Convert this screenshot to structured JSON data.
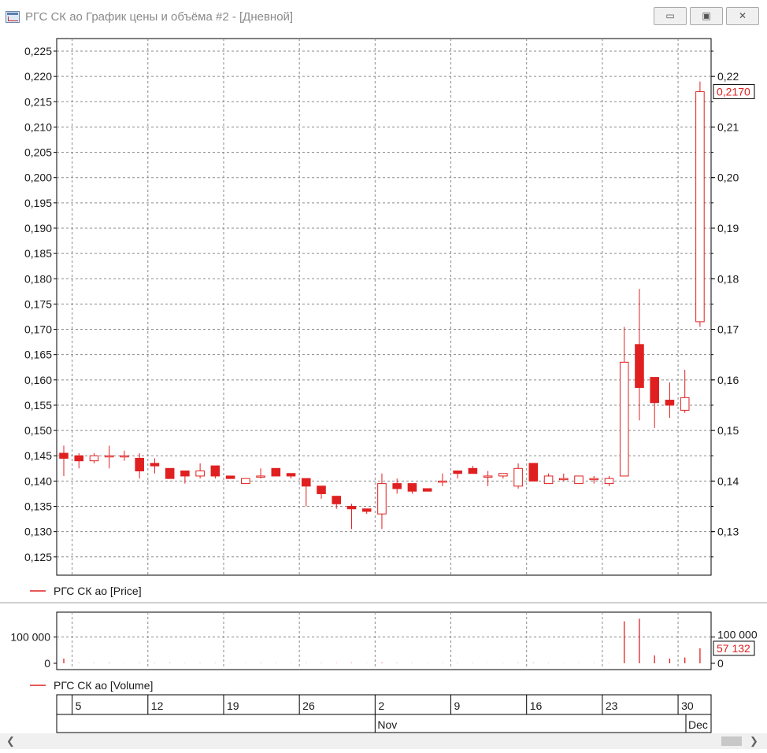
{
  "window": {
    "title": "РГС СК ао График цены и объёма #2 - [Дневной]",
    "buttons": {
      "minimize": "▭",
      "maximize": "▣",
      "close": "✕"
    }
  },
  "colors": {
    "candle": "#e02020",
    "grid": "#8a8a8a",
    "axis": "#000000",
    "text": "#1a1a1a"
  },
  "chart_data": [
    {
      "type": "candlestick",
      "legend": "РГС СК ао [Price]",
      "left_axis": {
        "min": 0.125,
        "max": 0.225,
        "step": 0.005,
        "labels": [
          "0,125",
          "0,130",
          "0,135",
          "0,140",
          "0,145",
          "0,150",
          "0,155",
          "0,160",
          "0,165",
          "0,170",
          "0,175",
          "0,180",
          "0,185",
          "0,190",
          "0,195",
          "0,200",
          "0,205",
          "0,210",
          "0,215",
          "0,220",
          "0,225"
        ]
      },
      "right_axis": {
        "ticks": [
          0.13,
          0.14,
          0.15,
          0.16,
          0.17,
          0.18,
          0.19,
          0.2,
          0.21,
          0.22
        ],
        "labels": [
          "0,13",
          "0,14",
          "0,15",
          "0,16",
          "0,17",
          "0,18",
          "0,19",
          "0,20",
          "0,21",
          "0,22"
        ]
      },
      "last_value_label": "0,2170",
      "last_value": 0.217,
      "grid": true,
      "candles": [
        {
          "o": 0.1455,
          "h": 0.147,
          "l": 0.141,
          "c": 0.1445
        },
        {
          "o": 0.145,
          "h": 0.1455,
          "l": 0.1425,
          "c": 0.144
        },
        {
          "o": 0.144,
          "h": 0.1455,
          "l": 0.1435,
          "c": 0.145
        },
        {
          "o": 0.145,
          "h": 0.147,
          "l": 0.1425,
          "c": 0.145
        },
        {
          "o": 0.145,
          "h": 0.146,
          "l": 0.144,
          "c": 0.145
        },
        {
          "o": 0.1445,
          "h": 0.1455,
          "l": 0.1405,
          "c": 0.142
        },
        {
          "o": 0.1435,
          "h": 0.1445,
          "l": 0.1415,
          "c": 0.143
        },
        {
          "o": 0.1425,
          "h": 0.1425,
          "l": 0.1405,
          "c": 0.1405
        },
        {
          "o": 0.142,
          "h": 0.142,
          "l": 0.1395,
          "c": 0.141
        },
        {
          "o": 0.141,
          "h": 0.1435,
          "l": 0.1405,
          "c": 0.142
        },
        {
          "o": 0.143,
          "h": 0.143,
          "l": 0.1405,
          "c": 0.141
        },
        {
          "o": 0.141,
          "h": 0.141,
          "l": 0.1405,
          "c": 0.1405
        },
        {
          "o": 0.1395,
          "h": 0.1405,
          "l": 0.1395,
          "c": 0.1405
        },
        {
          "o": 0.141,
          "h": 0.1425,
          "l": 0.1405,
          "c": 0.141
        },
        {
          "o": 0.1425,
          "h": 0.1425,
          "l": 0.141,
          "c": 0.141
        },
        {
          "o": 0.1415,
          "h": 0.1415,
          "l": 0.1405,
          "c": 0.141
        },
        {
          "o": 0.1405,
          "h": 0.1405,
          "l": 0.135,
          "c": 0.139
        },
        {
          "o": 0.139,
          "h": 0.139,
          "l": 0.1365,
          "c": 0.1375
        },
        {
          "o": 0.137,
          "h": 0.137,
          "l": 0.1345,
          "c": 0.1355
        },
        {
          "o": 0.135,
          "h": 0.1355,
          "l": 0.1305,
          "c": 0.1345
        },
        {
          "o": 0.1345,
          "h": 0.1345,
          "l": 0.1335,
          "c": 0.134
        },
        {
          "o": 0.1335,
          "h": 0.1415,
          "l": 0.1305,
          "c": 0.1395
        },
        {
          "o": 0.1395,
          "h": 0.1405,
          "l": 0.1375,
          "c": 0.1385
        },
        {
          "o": 0.1395,
          "h": 0.1395,
          "l": 0.1375,
          "c": 0.138
        },
        {
          "o": 0.1385,
          "h": 0.1385,
          "l": 0.138,
          "c": 0.138
        },
        {
          "o": 0.14,
          "h": 0.1415,
          "l": 0.139,
          "c": 0.14
        },
        {
          "o": 0.142,
          "h": 0.142,
          "l": 0.1405,
          "c": 0.1415
        },
        {
          "o": 0.1425,
          "h": 0.143,
          "l": 0.1415,
          "c": 0.1415
        },
        {
          "o": 0.141,
          "h": 0.142,
          "l": 0.139,
          "c": 0.141
        },
        {
          "o": 0.141,
          "h": 0.1415,
          "l": 0.1405,
          "c": 0.1415
        },
        {
          "o": 0.139,
          "h": 0.1435,
          "l": 0.1385,
          "c": 0.1425
        },
        {
          "o": 0.1435,
          "h": 0.1435,
          "l": 0.14,
          "c": 0.14
        },
        {
          "o": 0.1395,
          "h": 0.1415,
          "l": 0.1395,
          "c": 0.141
        },
        {
          "o": 0.1405,
          "h": 0.1415,
          "l": 0.14,
          "c": 0.1405
        },
        {
          "o": 0.1395,
          "h": 0.141,
          "l": 0.1395,
          "c": 0.141
        },
        {
          "o": 0.1405,
          "h": 0.141,
          "l": 0.1395,
          "c": 0.1405
        },
        {
          "o": 0.1395,
          "h": 0.141,
          "l": 0.139,
          "c": 0.1405
        },
        {
          "o": 0.141,
          "h": 0.1705,
          "l": 0.141,
          "c": 0.1635
        },
        {
          "o": 0.167,
          "h": 0.178,
          "l": 0.152,
          "c": 0.1585
        },
        {
          "o": 0.1605,
          "h": 0.1605,
          "l": 0.1505,
          "c": 0.1555
        },
        {
          "o": 0.156,
          "h": 0.1595,
          "l": 0.1525,
          "c": 0.155
        },
        {
          "o": 0.154,
          "h": 0.162,
          "l": 0.1535,
          "c": 0.1565
        },
        {
          "o": 0.1715,
          "h": 0.219,
          "l": 0.1705,
          "c": 0.217
        }
      ]
    },
    {
      "type": "bar",
      "legend": "РГС СК ао [Volume]",
      "left_axis_labels": [
        "0",
        "100 000"
      ],
      "right_axis_labels": [
        "0",
        "100 000"
      ],
      "ylim": [
        0,
        180000
      ],
      "last_value_label": "57 132",
      "last_value": 57132,
      "values": [
        18000,
        1000,
        1000,
        1500,
        500,
        1000,
        800,
        1200,
        700,
        900,
        800,
        600,
        500,
        1000,
        700,
        500,
        800,
        1000,
        900,
        1500,
        600,
        2000,
        1000,
        800,
        500,
        700,
        900,
        800,
        500,
        600,
        1000,
        1200,
        700,
        500,
        600,
        800,
        900,
        160000,
        170000,
        30000,
        18000,
        22000,
        57132
      ]
    }
  ],
  "time_axis": {
    "day_labels": [
      "5",
      "12",
      "19",
      "26",
      "2",
      "9",
      "16",
      "23",
      "30"
    ],
    "day_label_indexes": [
      1,
      6,
      11,
      16,
      21,
      26,
      31,
      36,
      41
    ],
    "month_labels": [
      "Nov",
      "Dec"
    ],
    "month_label_indexes": [
      21,
      43
    ]
  }
}
